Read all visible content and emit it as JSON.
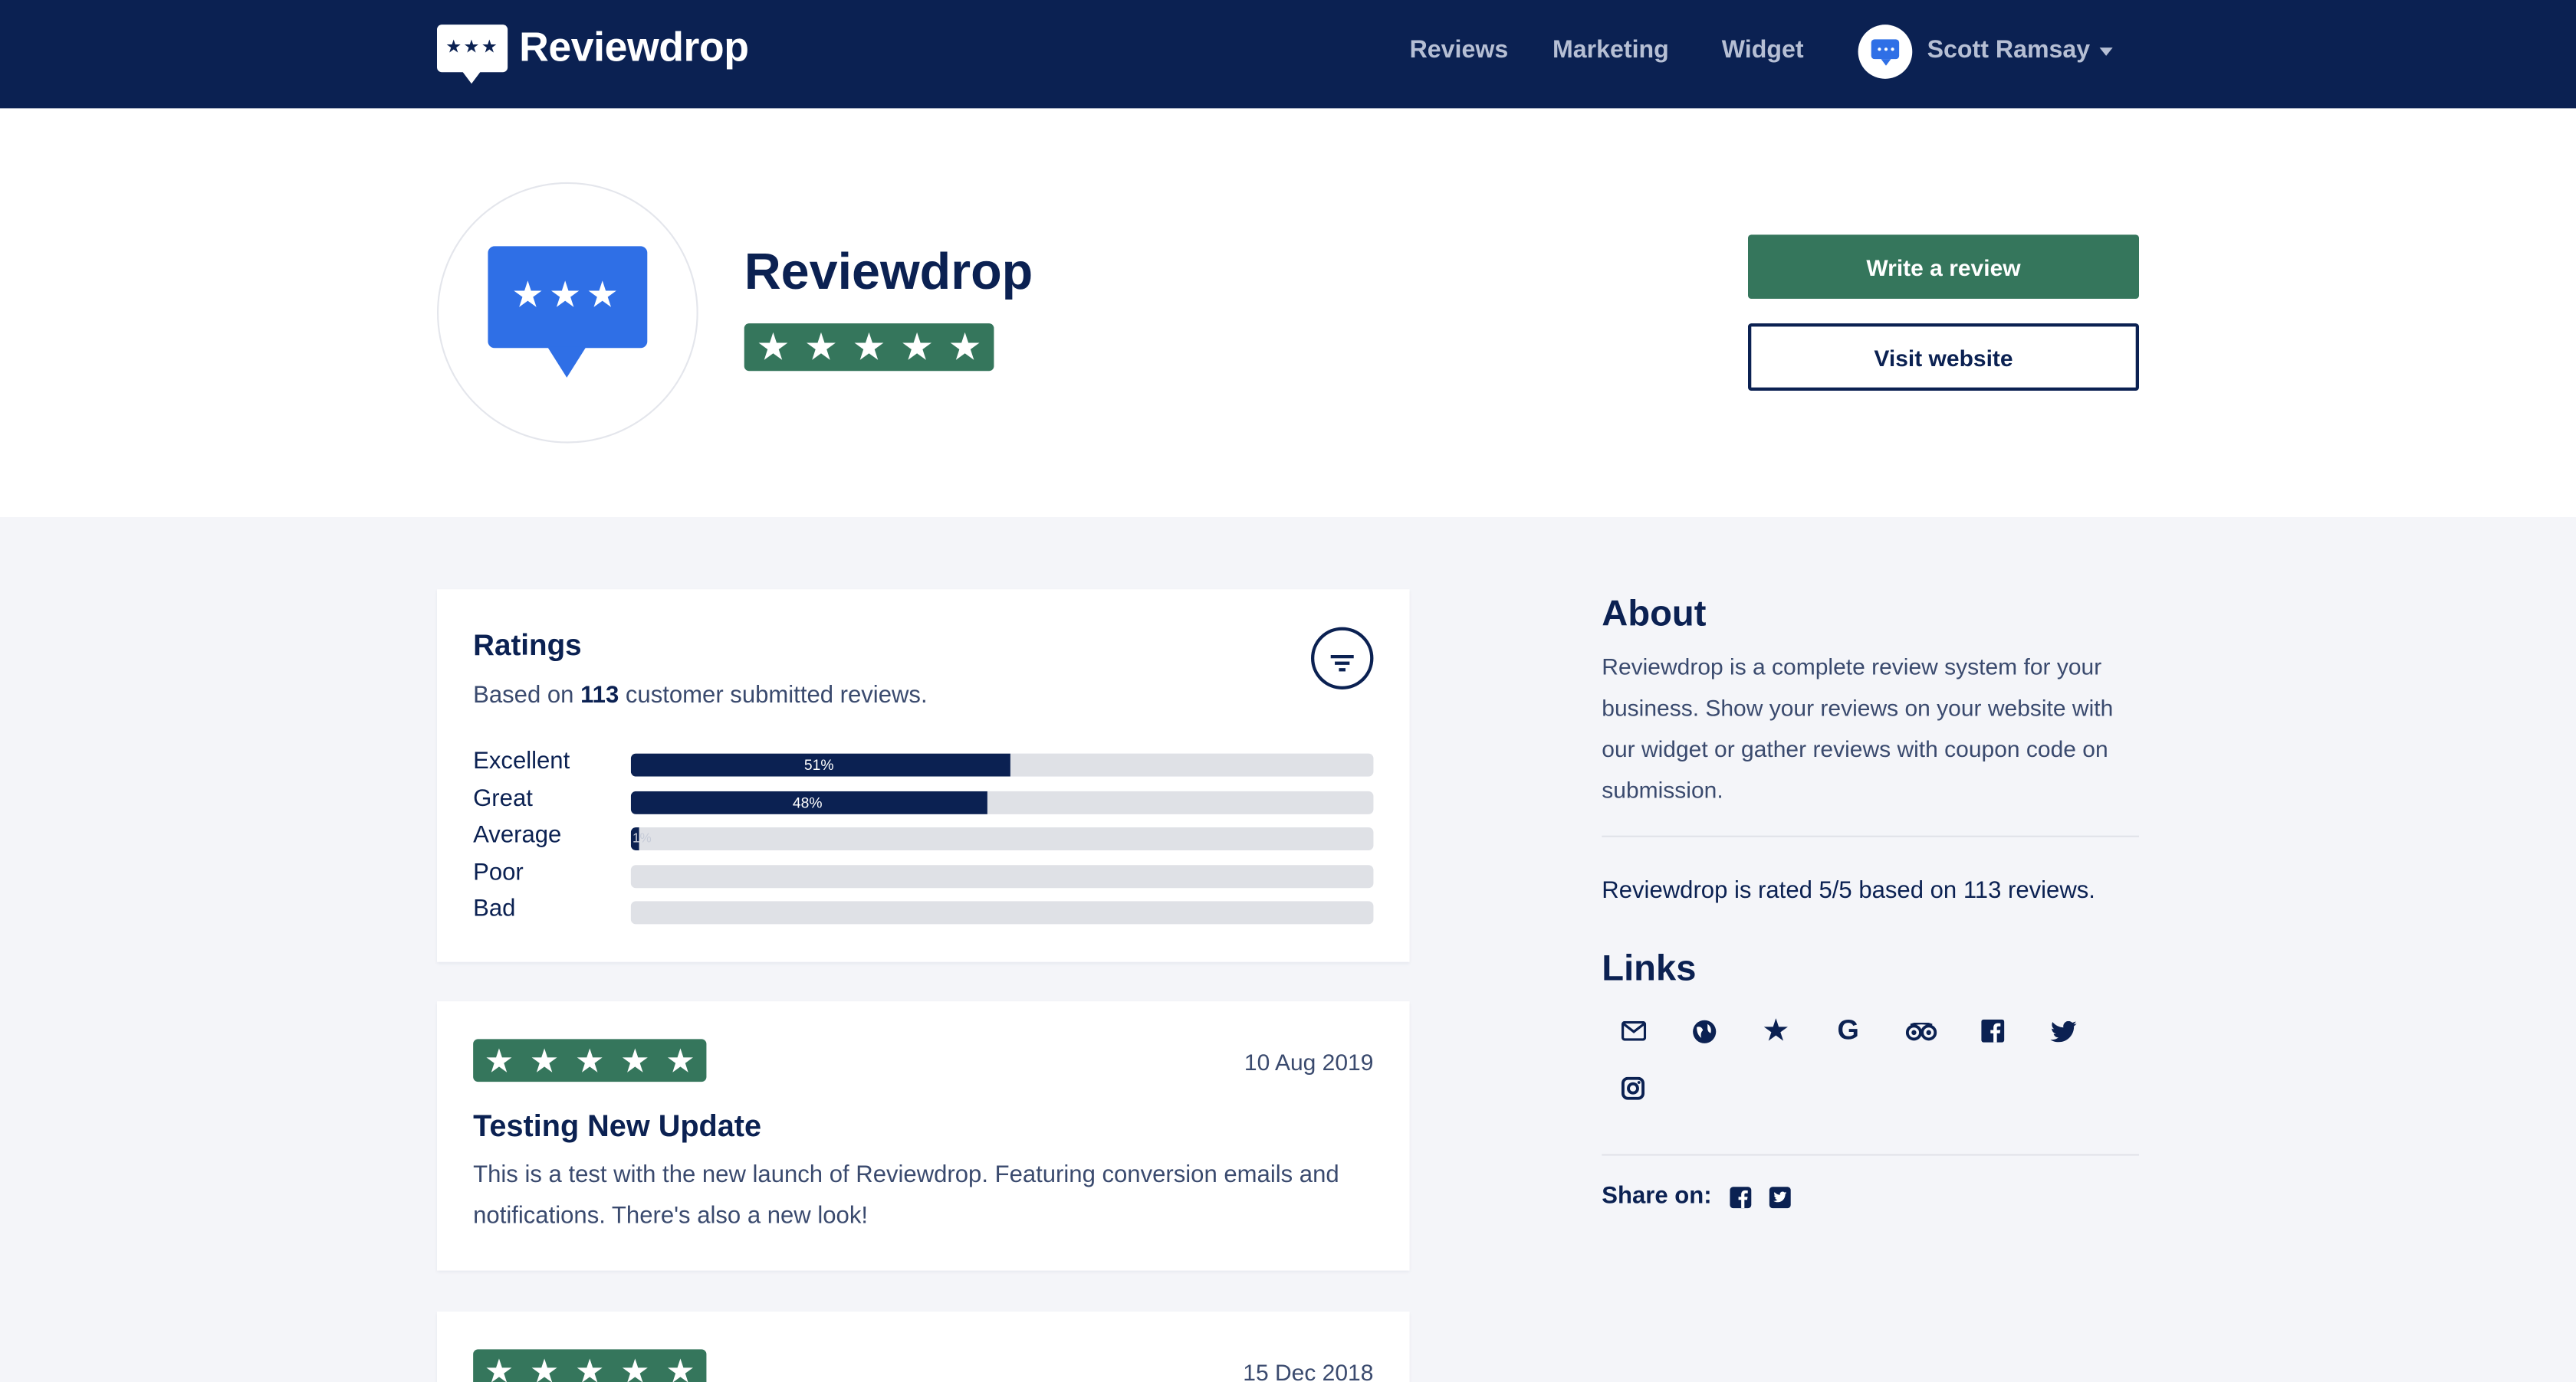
{
  "nav": {
    "brand": "Reviewdrop",
    "links": [
      "Reviews",
      "Marketing",
      "Widget"
    ],
    "user_name": "Scott Ramsay"
  },
  "hero": {
    "title": "Reviewdrop",
    "stars": 5,
    "write_review": "Write a review",
    "visit_website": "Visit website"
  },
  "ratings": {
    "heading": "Ratings",
    "based_prefix": "Based on",
    "based_count": "113",
    "based_suffix": "customer submitted reviews.",
    "rows": [
      {
        "label": "Excellent",
        "percent": 51,
        "display": "51%"
      },
      {
        "label": "Great",
        "percent": 48,
        "display": "48%"
      },
      {
        "label": "Average",
        "percent": 1,
        "display": "1%"
      },
      {
        "label": "Poor",
        "percent": 0,
        "display": ""
      },
      {
        "label": "Bad",
        "percent": 0,
        "display": ""
      }
    ]
  },
  "reviews": [
    {
      "stars": 5,
      "date": "10 Aug 2019",
      "title": "Testing New Update",
      "body": "This is a test with the new launch of Reviewdrop. Featuring conversion emails and notifications. There's also a new look!"
    },
    {
      "stars": 5,
      "date": "15 Dec 2018",
      "title": "",
      "body": ""
    }
  ],
  "about": {
    "heading": "About",
    "text": "Reviewdrop is a complete review system for your business. Show your reviews on your website with our widget or gather reviews with coupon code on submission.",
    "rated": "Reviewdrop is rated 5/5 based on 113 reviews."
  },
  "links": {
    "heading": "Links",
    "icons": [
      "email-icon",
      "globe-icon",
      "star-icon",
      "google-icon",
      "tripadvisor-icon",
      "facebook-icon",
      "twitter-icon",
      "instagram-icon"
    ]
  },
  "share": {
    "label": "Share on:",
    "icons": [
      "facebook-icon",
      "twitter-icon"
    ]
  },
  "colors": {
    "navy": "#0b2152",
    "green": "#35765c",
    "blue": "#2f6fe6",
    "background": "#f4f5f9"
  }
}
